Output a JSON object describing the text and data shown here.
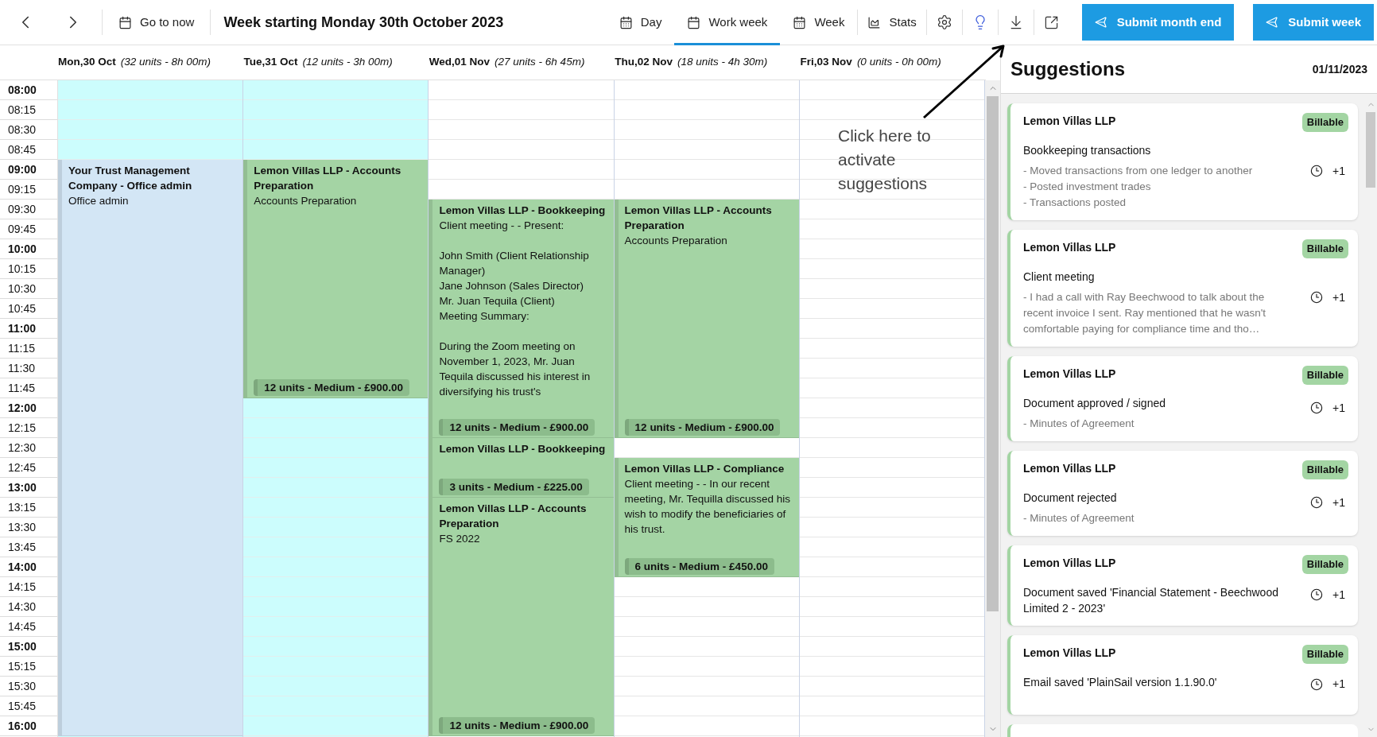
{
  "toolbar": {
    "go_to_now": "Go to now",
    "title": "Week starting Monday 30th October 2023",
    "views": [
      {
        "label": "Day",
        "selected": false
      },
      {
        "label": "Work week",
        "selected": true
      },
      {
        "label": "Week",
        "selected": false
      }
    ],
    "stats": "Stats",
    "submit_buttons": [
      "Submit month end",
      "Submit week"
    ]
  },
  "time_slots": [
    "08:00",
    "08:15",
    "08:30",
    "08:45",
    "09:00",
    "09:15",
    "09:30",
    "09:45",
    "10:00",
    "10:15",
    "10:30",
    "10:45",
    "11:00",
    "11:15",
    "11:30",
    "11:45",
    "12:00",
    "12:15",
    "12:30",
    "12:45",
    "13:00",
    "13:15",
    "13:30",
    "13:45",
    "14:00",
    "14:15",
    "14:30",
    "14:45",
    "15:00",
    "15:15",
    "15:30",
    "15:45",
    "16:00"
  ],
  "days": [
    {
      "day": "Mon,30 Oct",
      "summary": "(32 units - 8h 00m)",
      "highlighted": true,
      "events": [
        {
          "title": "Your Trust Management Company - Office admin",
          "description": "Office admin",
          "color": "#d3e6f5"
        }
      ]
    },
    {
      "day": "Tue,31 Oct",
      "summary": "(12 units - 3h 00m)",
      "highlighted": true,
      "events": [
        {
          "title": "Lemon Villas LLP - Accounts Preparation",
          "description": "Accounts Preparation",
          "footer": "12 units - Medium - £900.00",
          "color": "#a4d4a4"
        }
      ]
    },
    {
      "day": "Wed,01 Nov",
      "summary": "(27 units - 6h 45m)",
      "highlighted": false,
      "events": [
        {
          "title": "Lemon Villas LLP - Bookkeeping",
          "description": "Client meeting - - Present:\n\nJohn Smith (Client Relationship Manager)\nJane Johnson (Sales Director)\nMr. Juan Tequila (Client)\nMeeting Summary:\n\nDuring the Zoom meeting on November 1, 2023, Mr. Juan Tequila discussed his interest in diversifying his trust's",
          "footer": "12 units - Medium - £900.00",
          "color": "#a4d4a4"
        },
        {
          "title": "Lemon Villas LLP - Bookkeeping",
          "footer": "3 units - Medium - £225.00",
          "color": "#a4d4a4"
        },
        {
          "title": "Lemon Villas LLP - Accounts Preparation",
          "description": "FS 2022",
          "footer": "12 units - Medium - £900.00",
          "color": "#a4d4a4"
        }
      ]
    },
    {
      "day": "Thu,02 Nov",
      "summary": "(18 units - 4h 30m)",
      "highlighted": false,
      "events": [
        {
          "title": "Lemon Villas LLP - Accounts Preparation",
          "description": "Accounts Preparation",
          "footer": "12 units - Medium - £900.00",
          "color": "#a4d4a4"
        },
        {
          "title": "Lemon Villas LLP - Compliance",
          "description": "Client meeting - - In our recent meeting, Mr. Tequilla discussed his wish to modify the beneficiaries of his trust.",
          "footer": "6 units - Medium - £450.00",
          "color": "#a4d4a4"
        }
      ]
    },
    {
      "day": "Fri,03 Nov",
      "summary": "(0 units - 0h 00m)",
      "highlighted": false
    }
  ],
  "annotation": "Click here to activate suggestions",
  "suggestions": {
    "title": "Suggestions",
    "date": "01/11/2023",
    "items": [
      {
        "client": "Lemon Villas LLP",
        "badge": "Billable",
        "activity": "Bookkeeping transactions",
        "details": [
          "- Moved transactions from one ledger to another",
          "- Posted investment trades",
          "- Transactions posted"
        ],
        "count": "+1"
      },
      {
        "client": "Lemon Villas LLP",
        "badge": "Billable",
        "activity": "Client meeting",
        "details": [
          "- I had a call with Ray Beechwood to talk about the recent invoice I sent. Ray mentioned that he wasn't comfortable paying for compliance time and tho…"
        ],
        "count": "+1"
      },
      {
        "client": "Lemon Villas LLP",
        "badge": "Billable",
        "activity": "Document approved / signed",
        "details": [
          "- Minutes of Agreement"
        ],
        "count": "+1"
      },
      {
        "client": "Lemon Villas LLP",
        "badge": "Billable",
        "activity": "Document rejected",
        "details": [
          "- Minutes of Agreement"
        ],
        "count": "+1"
      },
      {
        "client": "Lemon Villas LLP",
        "badge": "Billable",
        "activity": "Document saved 'Financial Statement - Beechwood Limited 2 - 2023'",
        "count": "+1"
      },
      {
        "client": "Lemon Villas LLP",
        "badge": "Billable",
        "activity": "Email saved 'PlainSail version 1.1.90.0'",
        "count": "+1"
      }
    ]
  }
}
